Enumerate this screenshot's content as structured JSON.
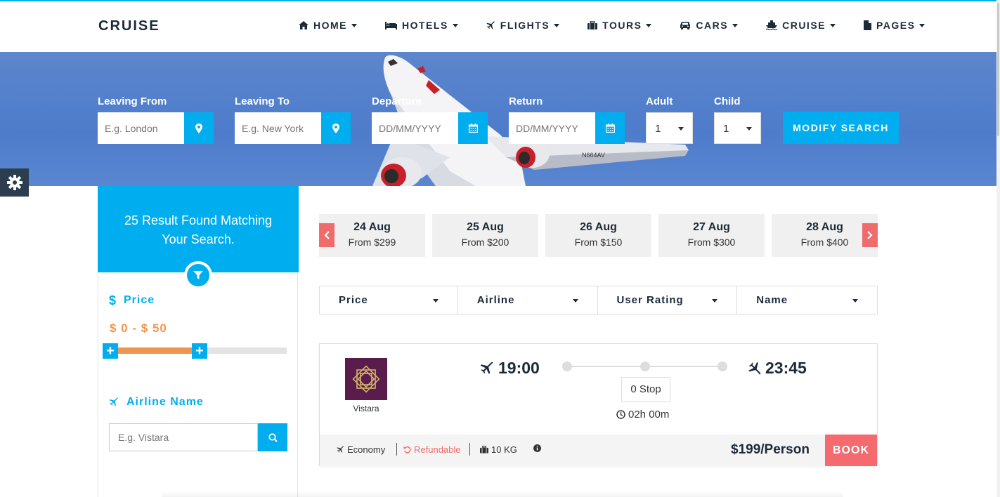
{
  "brand": "CRUISE",
  "nav": [
    {
      "label": "HOME",
      "icon": "home-icon"
    },
    {
      "label": "HOTELS",
      "icon": "bed-icon"
    },
    {
      "label": "FLIGHTS",
      "icon": "plane-icon"
    },
    {
      "label": "TOURS",
      "icon": "suitcase-icon"
    },
    {
      "label": "CARS",
      "icon": "car-icon"
    },
    {
      "label": "CRUISE",
      "icon": "ship-icon"
    },
    {
      "label": "PAGES",
      "icon": "file-icon"
    }
  ],
  "search": {
    "leaving_from": {
      "label": "Leaving From",
      "placeholder": "E.g. London"
    },
    "leaving_to": {
      "label": "Leaving To",
      "placeholder": "E.g. New York"
    },
    "departure": {
      "label": "Departure",
      "placeholder": "DD/MM/YYYY"
    },
    "return": {
      "label": "Return",
      "placeholder": "DD/MM/YYYY"
    },
    "adult": {
      "label": "Adult",
      "value": "1"
    },
    "child": {
      "label": "Child",
      "value": "1"
    },
    "modify_label": "MODIFY SEARCH"
  },
  "sidebar": {
    "result_text": "25 Result Found Matching Your Search.",
    "price_title": "Price",
    "price_range": "$ 0 - $ 50",
    "price_slider_fill": 0.5,
    "airline_title": "Airline Name",
    "airline_placeholder": "E.g. Vistara"
  },
  "dates": [
    {
      "date": "24 Aug",
      "price": "From $299"
    },
    {
      "date": "25 Aug",
      "price": "From $200"
    },
    {
      "date": "26 Aug",
      "price": "From $150"
    },
    {
      "date": "27 Aug",
      "price": "From $300"
    },
    {
      "date": "28 Aug",
      "price": "From $400"
    }
  ],
  "sort": [
    "Price",
    "Airline",
    "User Rating",
    "Name"
  ],
  "flight": {
    "airline": "Vistara",
    "depart": "19:00",
    "arrive": "23:45",
    "stops": "0 Stop",
    "duration": "02h 00m",
    "class": "Economy",
    "refund": "Refundable",
    "baggage": "10 KG",
    "price": "$199/Person",
    "book_label": "BOOK"
  },
  "colors": {
    "accent": "#00aeef",
    "orange": "#f0954f",
    "red": "#f46a6e",
    "dark": "#1c2a39"
  }
}
